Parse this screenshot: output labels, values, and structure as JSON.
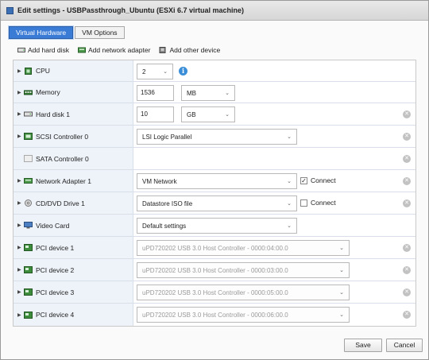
{
  "window": {
    "title": "Edit settings - USBPassthrough_Ubuntu (ESXi 6.7 virtual machine)"
  },
  "tabs": [
    {
      "label": "Virtual Hardware",
      "active": true
    },
    {
      "label": "VM Options",
      "active": false
    }
  ],
  "toolbar": {
    "add_hard_disk": "Add hard disk",
    "add_network_adapter": "Add network adapter",
    "add_other_device": "Add other device"
  },
  "devices": {
    "cpu": {
      "label": "CPU",
      "value": "2"
    },
    "memory": {
      "label": "Memory",
      "value": "1536",
      "unit": "MB"
    },
    "hard_disk": {
      "label": "Hard disk 1",
      "value": "10",
      "unit": "GB"
    },
    "scsi": {
      "label": "SCSI Controller 0",
      "value": "LSI Logic Parallel"
    },
    "sata": {
      "label": "SATA Controller 0"
    },
    "network": {
      "label": "Network Adapter 1",
      "value": "VM Network",
      "connect_label": "Connect",
      "connected": true
    },
    "cdrom": {
      "label": "CD/DVD Drive 1",
      "value": "Datastore ISO file",
      "connect_label": "Connect",
      "connected": false
    },
    "video": {
      "label": "Video Card",
      "value": "Default settings"
    },
    "pci": [
      {
        "label": "PCI device 1",
        "value": "uPD720202 USB 3.0 Host Controller - 0000:04:00.0"
      },
      {
        "label": "PCI device 2",
        "value": "uPD720202 USB 3.0 Host Controller - 0000:03:00.0"
      },
      {
        "label": "PCI device 3",
        "value": "uPD720202 USB 3.0 Host Controller - 0000:05:00.0"
      },
      {
        "label": "PCI device 4",
        "value": "uPD720202 USB 3.0 Host Controller - 0000:06:00.0"
      }
    ]
  },
  "footer": {
    "save": "Save",
    "cancel": "Cancel"
  },
  "colors": {
    "accent": "#3a7bd5",
    "panel": "#eef3f9"
  }
}
